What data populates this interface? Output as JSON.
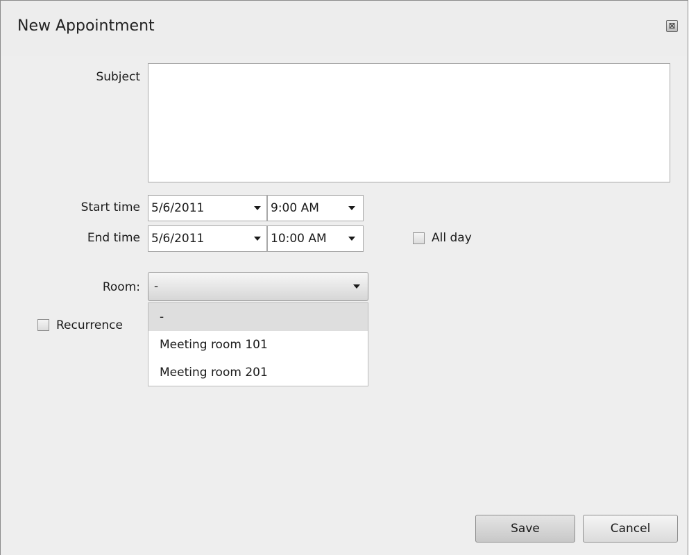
{
  "dialog": {
    "title": "New Appointment",
    "close_symbol": "⊠"
  },
  "form": {
    "subject_label": "Subject",
    "subject_value": "",
    "start_label": "Start time",
    "start_date": "5/6/2011",
    "start_time": "9:00 AM",
    "end_label": "End time",
    "end_date": "5/6/2011",
    "end_time": "10:00 AM",
    "all_day_label": "All day",
    "all_day_checked": false,
    "room_label": "Room:",
    "room_value": "-",
    "room_options": [
      "-",
      "Meeting room 101",
      "Meeting room 201"
    ],
    "recurrence_label": "Recurrence",
    "recurrence_checked": false
  },
  "buttons": {
    "save": "Save",
    "cancel": "Cancel"
  }
}
